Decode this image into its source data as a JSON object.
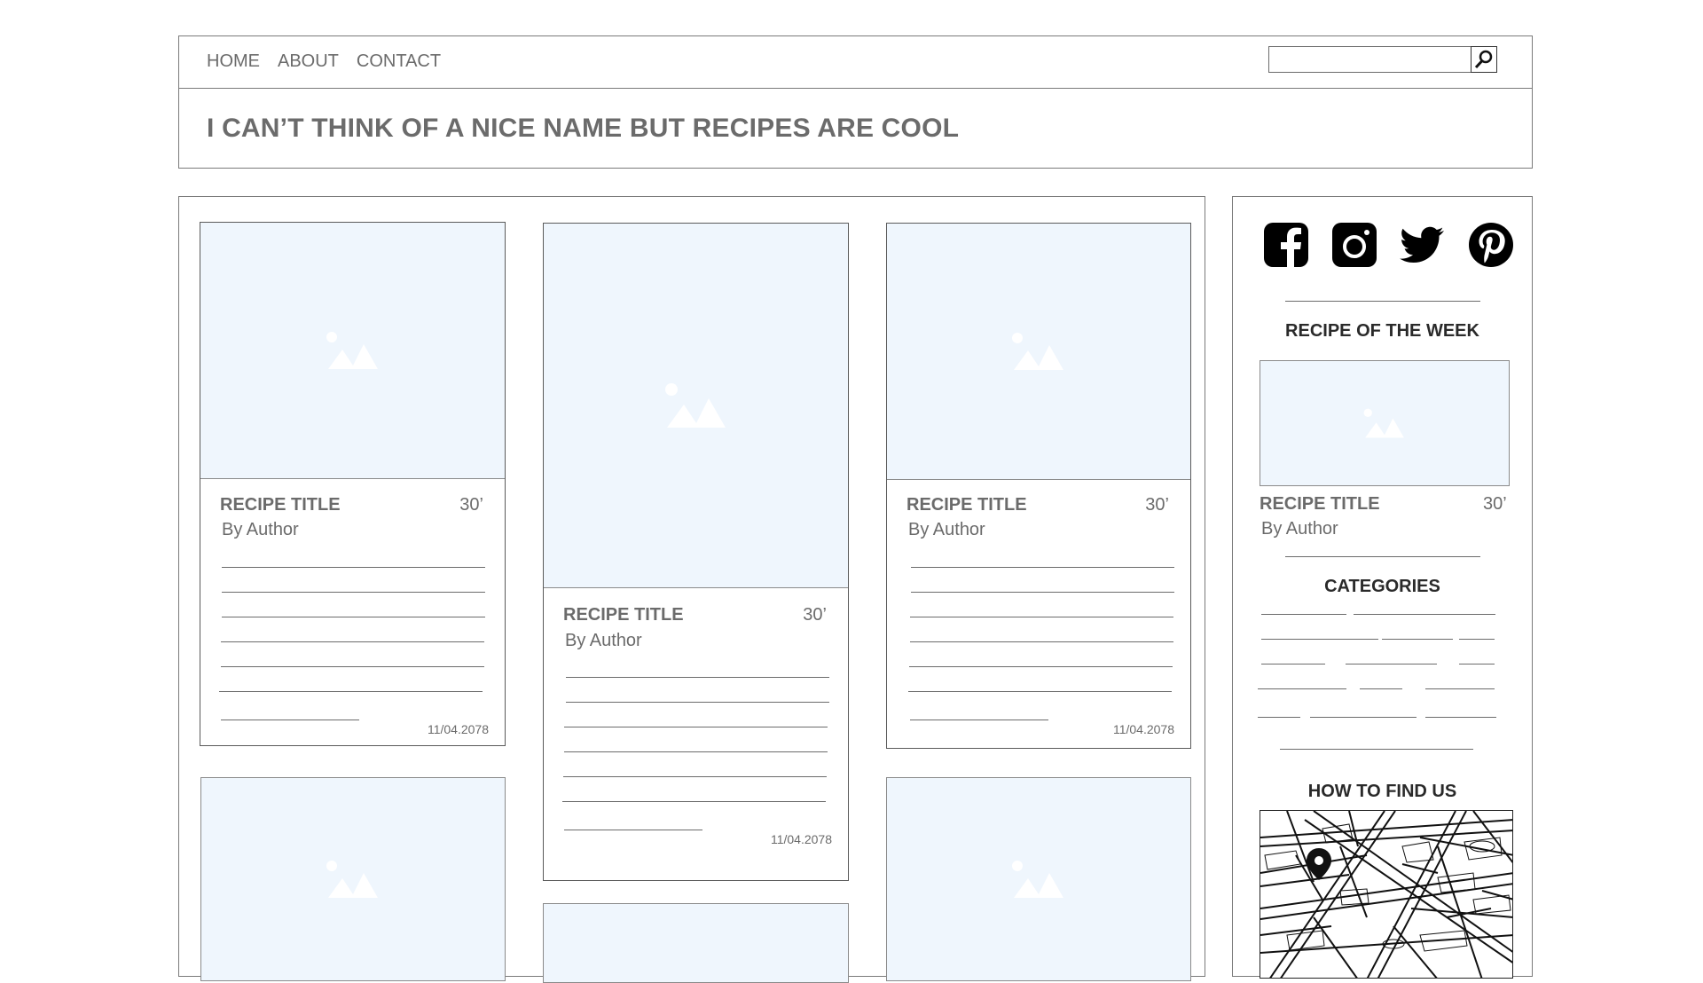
{
  "nav": {
    "items": [
      "HOME",
      "ABOUT",
      "CONTACT"
    ]
  },
  "search": {
    "placeholder": "",
    "icon": "search-icon"
  },
  "site": {
    "title": "I CAN’T THINK OF A NICE NAME BUT RECIPES ARE COOL"
  },
  "cards": [
    {
      "title": "RECIPE TITLE",
      "time": "30’",
      "author": "By Author",
      "date": "11/04.2078"
    },
    {
      "title": "RECIPE TITLE",
      "time": "30’",
      "author": "By Author",
      "date": "11/04.2078"
    },
    {
      "title": "RECIPE TITLE",
      "time": "30’",
      "author": "By Author",
      "date": "11/04.2078"
    }
  ],
  "sidebar": {
    "social_icons": [
      "facebook-icon",
      "instagram-icon",
      "twitter-icon",
      "pinterest-icon"
    ],
    "recipe_of_week": {
      "heading": "RECIPE OF THE WEEK",
      "title": "RECIPE TITLE",
      "time": "30’",
      "author": "By Author"
    },
    "categories_heading": "CATEGORIES",
    "find_us_heading": "HOW TO FIND US"
  },
  "colors": {
    "image_placeholder": "#eff6fd",
    "border": "#7a7a7a",
    "text": "#6b6b6b",
    "heading": "#2a2a2a"
  }
}
